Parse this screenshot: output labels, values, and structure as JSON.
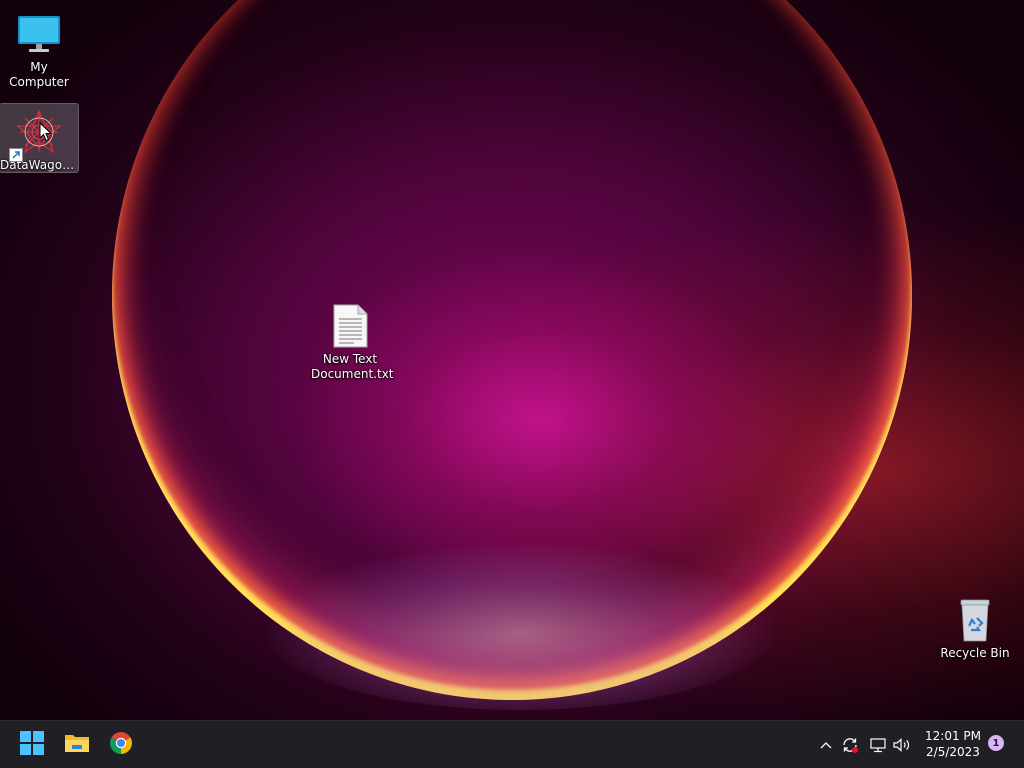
{
  "desktop": {
    "icons": {
      "my_computer": {
        "label": "My Computer",
        "icon": "monitor-icon"
      },
      "datawagon": {
        "label": "DataWagon...",
        "icon": "datawagon-icon"
      },
      "text_doc": {
        "label": "New Text Document.txt",
        "icon": "text-file-icon"
      },
      "recycle_bin": {
        "label": "Recycle Bin",
        "icon": "recycle-bin-icon"
      }
    }
  },
  "taskbar": {
    "pinned": [
      {
        "name": "Start",
        "icon": "windows-start-icon"
      },
      {
        "name": "File Explorer",
        "icon": "folder-icon"
      },
      {
        "name": "Google Chrome",
        "icon": "chrome-icon"
      }
    ],
    "tray": {
      "icons": [
        "chevron-up-icon",
        "sync-icon",
        "network-icon",
        "volume-icon"
      ],
      "time": "12:01 PM",
      "date": "2/5/2023",
      "notification_count": "1"
    }
  },
  "colors": {
    "taskbar": "#1f1f24",
    "accent": "#0078d4"
  }
}
